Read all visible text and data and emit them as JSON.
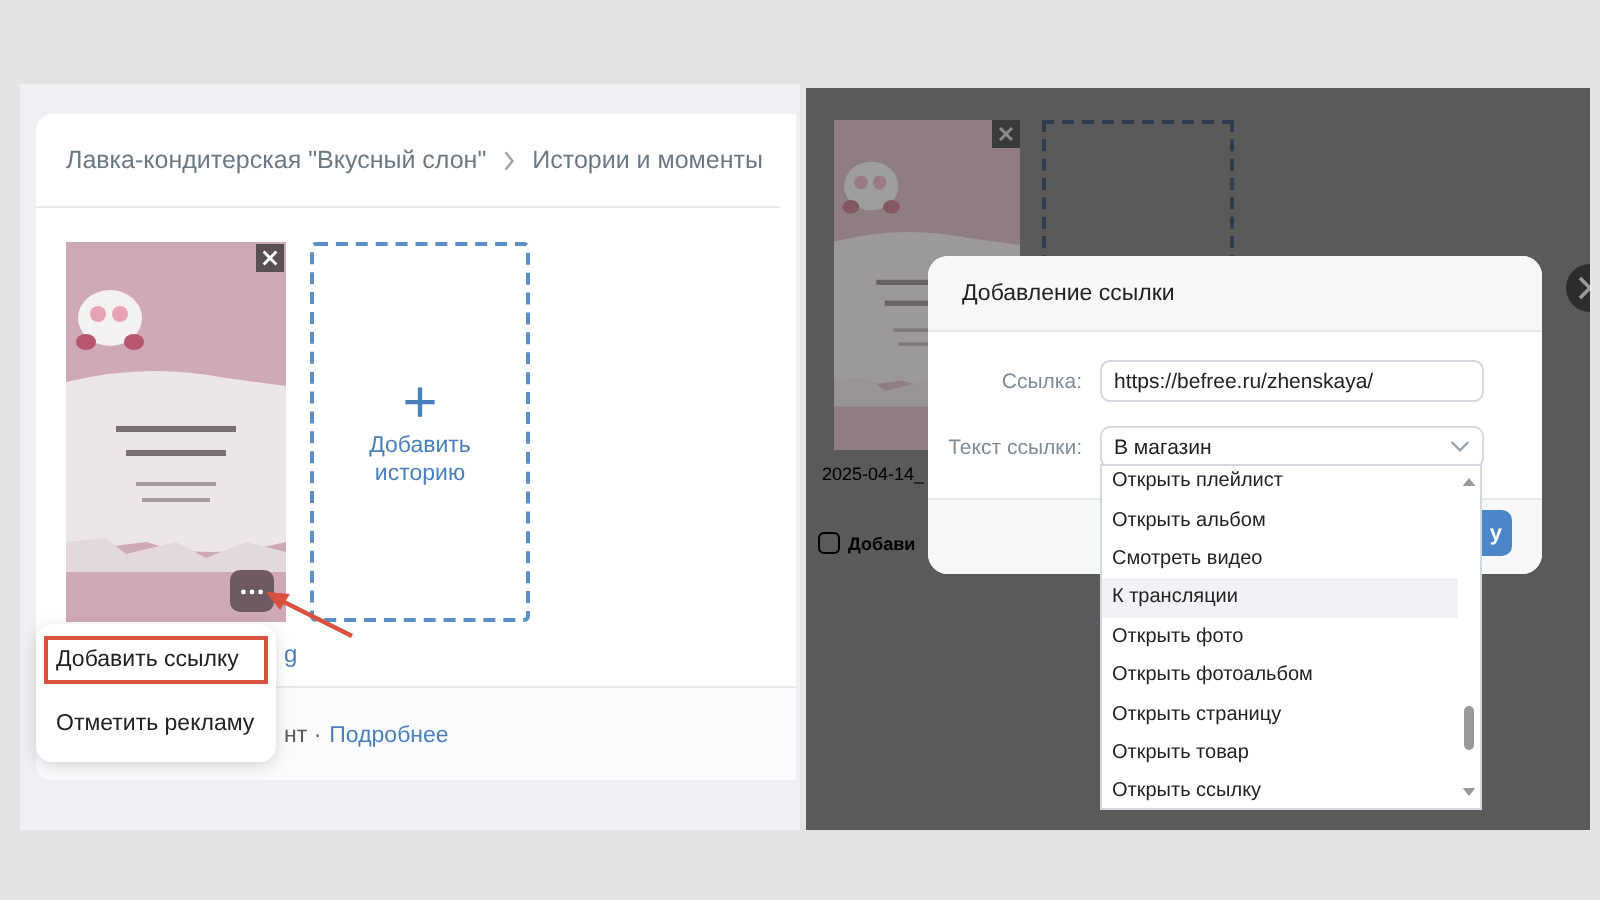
{
  "left": {
    "breadcrumb": [
      {
        "label": "Лавка-кондитерская \"Вкусный слон\""
      },
      {
        "label": "Истории и моменты"
      }
    ],
    "add_story": {
      "plus": "+",
      "label": "Добавить историю"
    },
    "date_link": "g",
    "context_menu": [
      {
        "label": "Добавить ссылку",
        "highlighted": true
      },
      {
        "label": "Отметить рекламу",
        "highlighted": false
      }
    ],
    "footer": {
      "text": "нт ·",
      "link": "Подробнее"
    }
  },
  "right": {
    "date": "2025-04-14_",
    "checkbox": {
      "label": "Добави",
      "checked": false
    },
    "dialog": {
      "title": "Добавление ссылки",
      "fields": [
        {
          "label": "Ссылка:",
          "kind": "input",
          "value": "https://befree.ru/zhenskaya/"
        },
        {
          "label": "Текст ссылки:",
          "kind": "select",
          "value": "В магазин"
        }
      ],
      "button": "у",
      "dropdown": [
        {
          "label": "Открыть плейлист",
          "selected": false
        },
        {
          "label": "Открыть альбом",
          "selected": false
        },
        {
          "label": "Смотреть видео",
          "selected": false
        },
        {
          "label": "К трансляции",
          "selected": true
        },
        {
          "label": "Открыть фото",
          "selected": false
        },
        {
          "label": "Открыть фотоальбом",
          "selected": false
        },
        {
          "label": "Открыть страницу",
          "selected": false
        },
        {
          "label": "Открыть товар",
          "selected": false
        },
        {
          "label": "Открыть ссылку",
          "selected": false
        }
      ]
    }
  }
}
